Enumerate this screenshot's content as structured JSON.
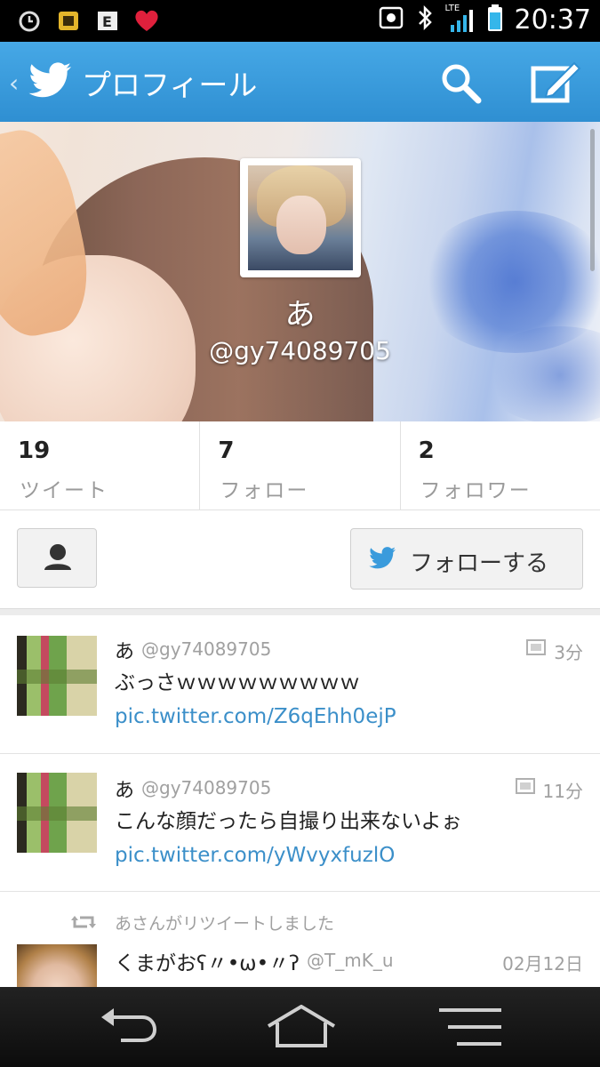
{
  "status_bar": {
    "time": "20:37",
    "network": "LTE",
    "icons_left": [
      "alarm-icon",
      "app-icon",
      "app-e-icon",
      "heart-icon"
    ],
    "icons_right": [
      "notification-icon",
      "bluetooth-icon",
      "signal-icon",
      "battery-icon"
    ]
  },
  "action_bar": {
    "title": "プロフィール",
    "back_symbol": "‹"
  },
  "profile": {
    "name": "あ",
    "handle": "@gy74089705"
  },
  "stats": [
    {
      "count": "19",
      "label": "ツイート"
    },
    {
      "count": "7",
      "label": "フォロー"
    },
    {
      "count": "2",
      "label": "フォロワー"
    }
  ],
  "actions": {
    "follow_label": "フォローする"
  },
  "tweets": [
    {
      "name": "あ",
      "handle": "@gy74089705",
      "time": "3分",
      "text": "ぶっさｗｗｗｗｗｗｗｗｗ ",
      "link": "pic.twitter.com/Z6qEhh0ejP"
    },
    {
      "name": "あ",
      "handle": "@gy74089705",
      "time": "11分",
      "text": "こんな顔だったら自撮り出来ないよぉ ",
      "link": "pic.twitter.com/yWvyxfuzlO"
    }
  ],
  "retweet": {
    "label": "あさんがリツイートしました",
    "name": "くまがおʕ〃•ω•〃ʔ",
    "handle": "@T_mK_u",
    "date": "02月12日"
  },
  "colors": {
    "action_bar": "#3a9bdc",
    "link": "#3b8fc9",
    "muted_text": "#a0a0a0"
  }
}
